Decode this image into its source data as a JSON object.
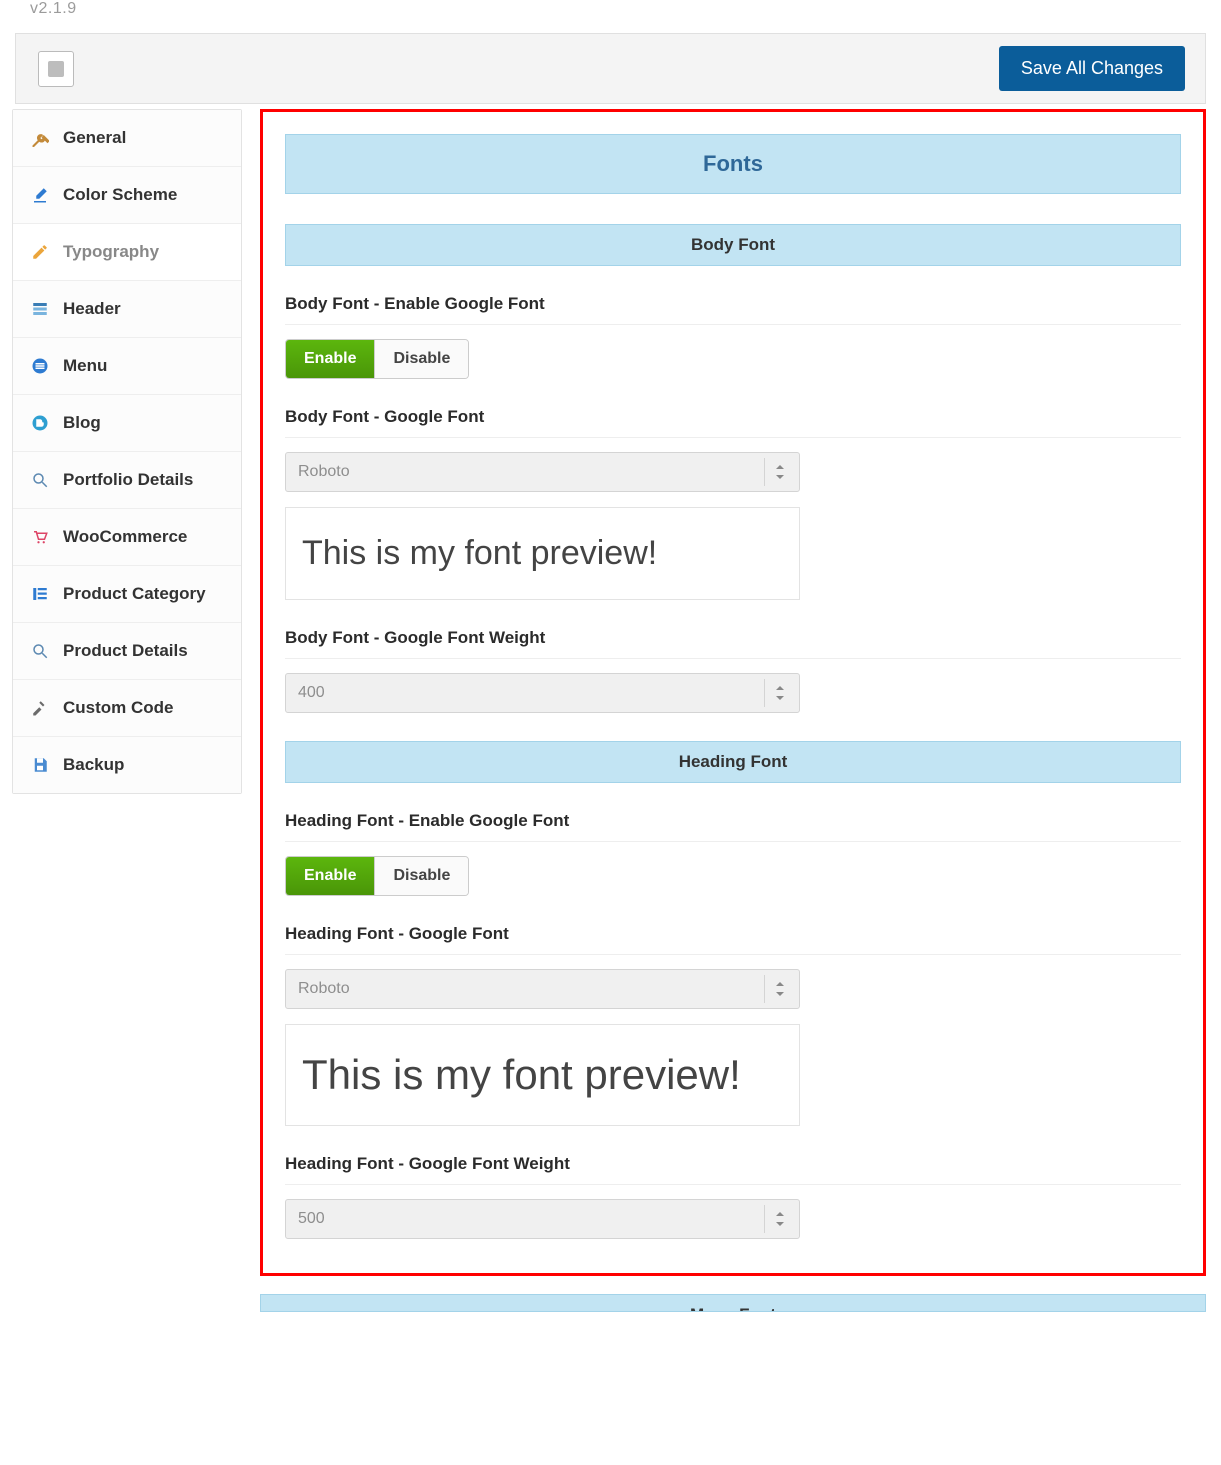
{
  "version": "v2.1.9",
  "save_button": "Save All Changes",
  "sidebar": {
    "items": [
      {
        "id": "general",
        "label": "General"
      },
      {
        "id": "color-scheme",
        "label": "Color Scheme"
      },
      {
        "id": "typography",
        "label": "Typography",
        "active": true
      },
      {
        "id": "header",
        "label": "Header"
      },
      {
        "id": "menu",
        "label": "Menu"
      },
      {
        "id": "blog",
        "label": "Blog"
      },
      {
        "id": "portfolio-details",
        "label": "Portfolio Details"
      },
      {
        "id": "woocommerce",
        "label": "WooCommerce"
      },
      {
        "id": "product-category",
        "label": "Product Category"
      },
      {
        "id": "product-details",
        "label": "Product Details"
      },
      {
        "id": "custom-code",
        "label": "Custom Code"
      },
      {
        "id": "backup",
        "label": "Backup"
      }
    ]
  },
  "panel": {
    "title": "Fonts",
    "sections": {
      "body": {
        "heading": "Body Font",
        "enable_label": "Body Font - Enable Google Font",
        "font_label": "Body Font - Google Font",
        "font_value": "Roboto",
        "preview": "This is my font preview!",
        "weight_label": "Body Font - Google Font Weight",
        "weight_value": "400"
      },
      "heading_font": {
        "heading": "Heading Font",
        "enable_label": "Heading Font - Enable Google Font",
        "font_label": "Heading Font - Google Font",
        "font_value": "Roboto",
        "preview": "This is my font preview!",
        "weight_label": "Heading Font - Google Font Weight",
        "weight_value": "500"
      },
      "menu_font": {
        "heading": "Menu Font"
      }
    }
  },
  "toggle": {
    "enable": "Enable",
    "disable": "Disable"
  }
}
